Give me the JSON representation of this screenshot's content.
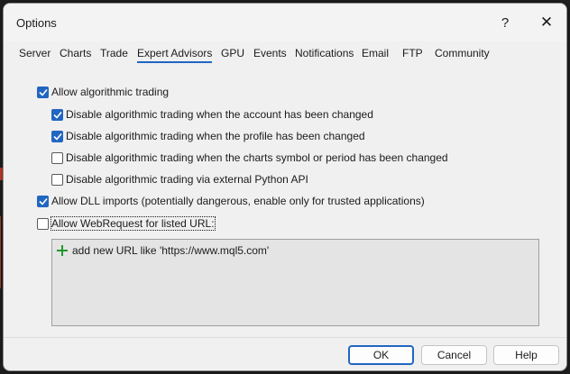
{
  "window": {
    "title": "Options",
    "help_glyph": "?",
    "close_glyph": "✕"
  },
  "tabs": [
    {
      "label": "Server",
      "active": false
    },
    {
      "label": "Charts",
      "active": false
    },
    {
      "label": "Trade",
      "active": false
    },
    {
      "label": "Expert Advisors",
      "active": true
    },
    {
      "label": "GPU",
      "active": false
    },
    {
      "label": "Events",
      "active": false
    },
    {
      "label": "Notifications",
      "active": false
    },
    {
      "label": "Email",
      "active": false
    },
    {
      "label": "FTP",
      "active": false
    },
    {
      "label": "Community",
      "active": false
    }
  ],
  "options": {
    "allow_algo": {
      "label": "Allow algorithmic trading",
      "checked": true
    },
    "disable_account": {
      "label": "Disable algorithmic trading when the account has been changed",
      "checked": true
    },
    "disable_profile": {
      "label": "Disable algorithmic trading when the profile has been changed",
      "checked": true
    },
    "disable_symbol": {
      "label": "Disable algorithmic trading when the charts symbol or period has been changed",
      "checked": false
    },
    "disable_python": {
      "label": "Disable algorithmic trading via external Python API",
      "checked": false
    },
    "allow_dll": {
      "label": "Allow DLL imports (potentially dangerous, enable only for trusted applications)",
      "checked": true
    },
    "allow_webrequest": {
      "label": "Allow WebRequest for listed URL:",
      "checked": false
    }
  },
  "url_list": {
    "add_label": "add new URL like 'https://www.mql5.com'"
  },
  "buttons": {
    "ok": "OK",
    "cancel": "Cancel",
    "help": "Help"
  },
  "colors": {
    "accent": "#2166c1",
    "add_icon": "#1f9a2c"
  }
}
